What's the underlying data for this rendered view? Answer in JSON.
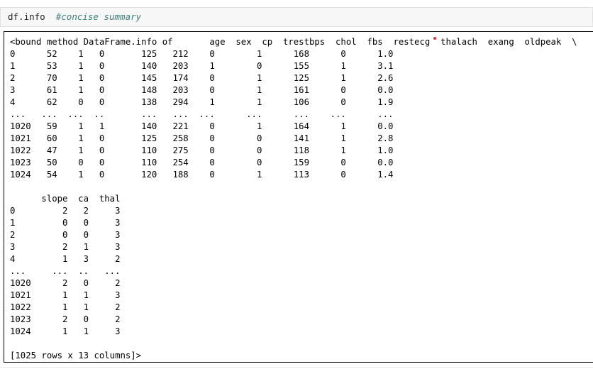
{
  "input_cell": {
    "code": "df.info",
    "comment": "#concise summary"
  },
  "output": {
    "lines": [
      "<bound method DataFrame.info of       age  sex  cp  trestbps  chol  fbs  restecg  thalach  exang  oldpeak  \\",
      "0      52    1   0       125   212    0        1      168      0      1.0",
      "1      53    1   0       140   203    1        0      155      1      3.1",
      "2      70    1   0       145   174    0        1      125      1      2.6",
      "3      61    1   0       148   203    0        1      161      0      0.0",
      "4      62    0   0       138   294    1        1      106      0      1.9",
      "...   ...  ...  ..       ...   ...  ...      ...      ...    ...      ...",
      "1020   59    1   1       140   221    0        1      164      1      0.0",
      "1021   60    1   0       125   258    0        0      141      1      2.8",
      "1022   47    1   0       110   275    0        0      118      1      1.0",
      "1023   50    0   0       110   254    0        0      159      0      0.0",
      "1024   54    1   0       120   188    0        1      113      0      1.4",
      "",
      "      slope  ca  thal",
      "0         2   2     3",
      "1         0   0     3",
      "2         0   0     3",
      "3         2   1     3",
      "4         1   3     2",
      "...     ...  ..   ...",
      "1020      2   0     2",
      "1021      1   1     3",
      "1022      1   1     2",
      "1023      2   0     2",
      "1024      1   1     3",
      "",
      "[1025 rows x 13 columns]>"
    ]
  }
}
